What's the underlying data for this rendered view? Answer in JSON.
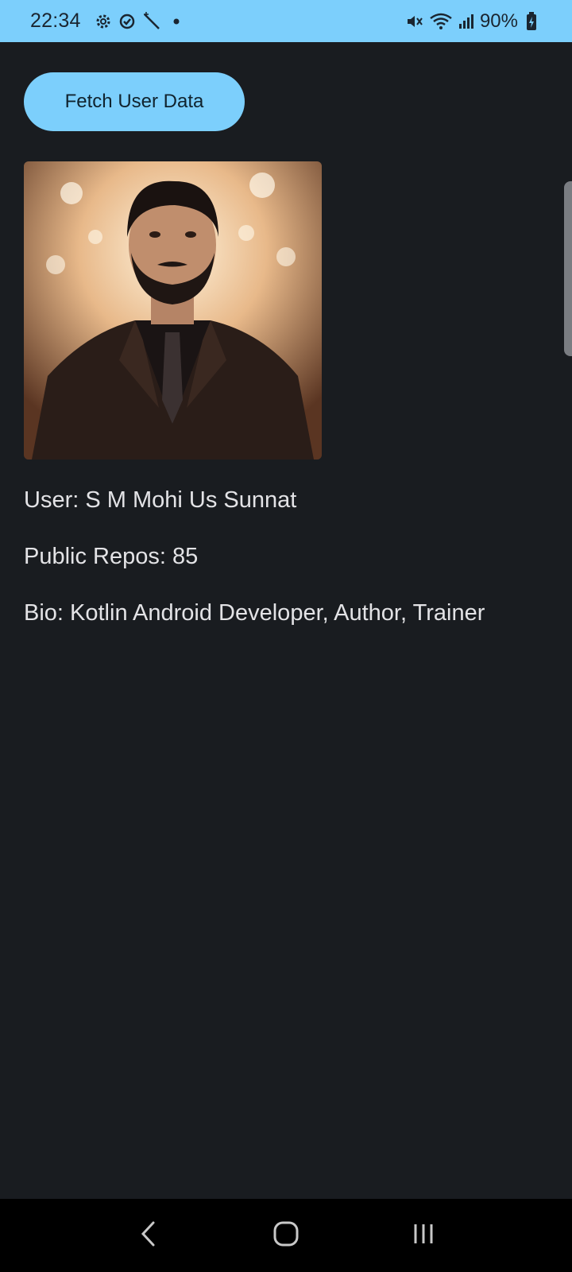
{
  "status_bar": {
    "time": "22:34",
    "battery": "90%",
    "icons": [
      "settings-icon",
      "sync-icon",
      "magic-wand-icon",
      "notification-dot-icon",
      "mute-icon",
      "wifi-icon",
      "signal-icon",
      "battery-charging-icon"
    ]
  },
  "app": {
    "fetch_button_label": "Fetch User Data",
    "user_line": "User: S M Mohi Us Sunnat",
    "repos_line": "Public Repos: 85",
    "bio_line": "Bio: Kotlin Android Developer, Author, Trainer"
  },
  "nav_bar": {
    "icons": [
      "back-icon",
      "home-icon",
      "recent-apps-icon"
    ]
  },
  "colors": {
    "accent": "#7ccffc",
    "background": "#191c20",
    "text": "#e3e3e6"
  }
}
